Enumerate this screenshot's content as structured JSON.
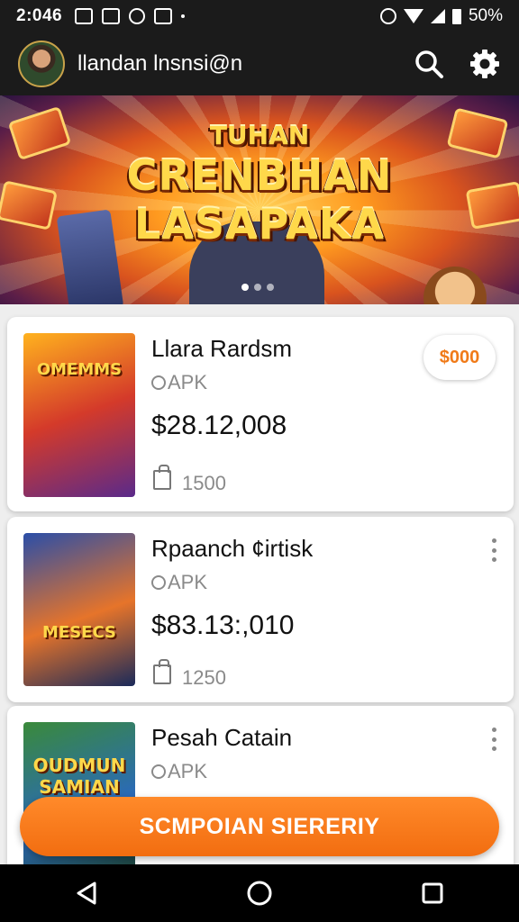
{
  "status_bar": {
    "time": "2:046",
    "battery": "50%"
  },
  "app_bar": {
    "title": "llandan lnsnsi@n"
  },
  "banner": {
    "line1": "TUHAN",
    "line2": "CRENBHAN",
    "line3": "LASAPAKA",
    "dots": 3,
    "active_dot": 0
  },
  "items": [
    {
      "title": "Llara Rardsm",
      "type": "APK",
      "price": "$28.12,008",
      "count": "1500",
      "badge": "$000",
      "thumb_label": "OMEMMS",
      "thumb_colors": [
        "#ffb21e",
        "#d43a2a",
        "#5a2a8a"
      ]
    },
    {
      "title": "Rpaanch ¢irtisk",
      "type": "APK",
      "price": "$83.13:,010",
      "count": "1250",
      "thumb_label": "MESECS",
      "thumb_colors": [
        "#2a4ea8",
        "#e6742a",
        "#1a2a5a"
      ]
    },
    {
      "title": "Pesah Catain",
      "type": "APK",
      "price": "",
      "count": "",
      "thumb_label": "OUDMUN SAMIAN",
      "thumb_colors": [
        "#3a8a3a",
        "#2a6ab8",
        "#1a3a1a"
      ]
    }
  ],
  "cta": {
    "label": "SCMPOIAN SIERERIY"
  },
  "colors": {
    "accent": "#f47a1a",
    "bar_bg": "#1b1b1b"
  },
  "icons": [
    "search-icon",
    "settings-icon",
    "back-icon",
    "home-icon",
    "recents-icon",
    "more-vert-icon"
  ]
}
